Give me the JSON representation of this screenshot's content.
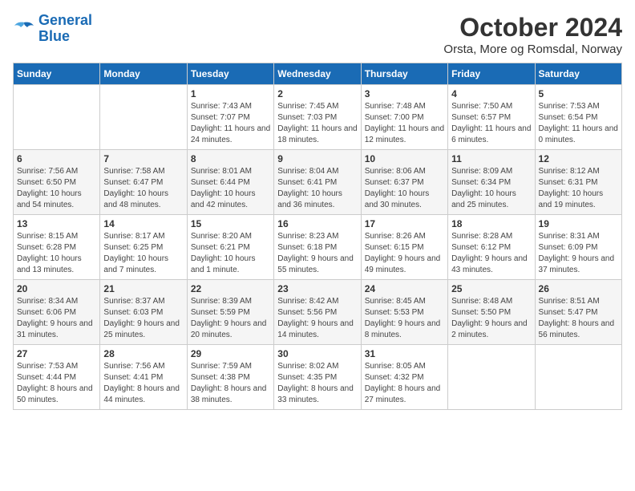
{
  "header": {
    "logo_line1": "General",
    "logo_line2": "Blue",
    "title": "October 2024",
    "subtitle": "Orsta, More og Romsdal, Norway"
  },
  "calendar": {
    "days_of_week": [
      "Sunday",
      "Monday",
      "Tuesday",
      "Wednesday",
      "Thursday",
      "Friday",
      "Saturday"
    ],
    "weeks": [
      [
        {
          "day": "",
          "empty": true
        },
        {
          "day": "",
          "empty": true
        },
        {
          "day": "1",
          "sunrise": "Sunrise: 7:43 AM",
          "sunset": "Sunset: 7:07 PM",
          "daylight": "Daylight: 11 hours and 24 minutes."
        },
        {
          "day": "2",
          "sunrise": "Sunrise: 7:45 AM",
          "sunset": "Sunset: 7:03 PM",
          "daylight": "Daylight: 11 hours and 18 minutes."
        },
        {
          "day": "3",
          "sunrise": "Sunrise: 7:48 AM",
          "sunset": "Sunset: 7:00 PM",
          "daylight": "Daylight: 11 hours and 12 minutes."
        },
        {
          "day": "4",
          "sunrise": "Sunrise: 7:50 AM",
          "sunset": "Sunset: 6:57 PM",
          "daylight": "Daylight: 11 hours and 6 minutes."
        },
        {
          "day": "5",
          "sunrise": "Sunrise: 7:53 AM",
          "sunset": "Sunset: 6:54 PM",
          "daylight": "Daylight: 11 hours and 0 minutes."
        }
      ],
      [
        {
          "day": "6",
          "sunrise": "Sunrise: 7:56 AM",
          "sunset": "Sunset: 6:50 PM",
          "daylight": "Daylight: 10 hours and 54 minutes."
        },
        {
          "day": "7",
          "sunrise": "Sunrise: 7:58 AM",
          "sunset": "Sunset: 6:47 PM",
          "daylight": "Daylight: 10 hours and 48 minutes."
        },
        {
          "day": "8",
          "sunrise": "Sunrise: 8:01 AM",
          "sunset": "Sunset: 6:44 PM",
          "daylight": "Daylight: 10 hours and 42 minutes."
        },
        {
          "day": "9",
          "sunrise": "Sunrise: 8:04 AM",
          "sunset": "Sunset: 6:41 PM",
          "daylight": "Daylight: 10 hours and 36 minutes."
        },
        {
          "day": "10",
          "sunrise": "Sunrise: 8:06 AM",
          "sunset": "Sunset: 6:37 PM",
          "daylight": "Daylight: 10 hours and 30 minutes."
        },
        {
          "day": "11",
          "sunrise": "Sunrise: 8:09 AM",
          "sunset": "Sunset: 6:34 PM",
          "daylight": "Daylight: 10 hours and 25 minutes."
        },
        {
          "day": "12",
          "sunrise": "Sunrise: 8:12 AM",
          "sunset": "Sunset: 6:31 PM",
          "daylight": "Daylight: 10 hours and 19 minutes."
        }
      ],
      [
        {
          "day": "13",
          "sunrise": "Sunrise: 8:15 AM",
          "sunset": "Sunset: 6:28 PM",
          "daylight": "Daylight: 10 hours and 13 minutes."
        },
        {
          "day": "14",
          "sunrise": "Sunrise: 8:17 AM",
          "sunset": "Sunset: 6:25 PM",
          "daylight": "Daylight: 10 hours and 7 minutes."
        },
        {
          "day": "15",
          "sunrise": "Sunrise: 8:20 AM",
          "sunset": "Sunset: 6:21 PM",
          "daylight": "Daylight: 10 hours and 1 minute."
        },
        {
          "day": "16",
          "sunrise": "Sunrise: 8:23 AM",
          "sunset": "Sunset: 6:18 PM",
          "daylight": "Daylight: 9 hours and 55 minutes."
        },
        {
          "day": "17",
          "sunrise": "Sunrise: 8:26 AM",
          "sunset": "Sunset: 6:15 PM",
          "daylight": "Daylight: 9 hours and 49 minutes."
        },
        {
          "day": "18",
          "sunrise": "Sunrise: 8:28 AM",
          "sunset": "Sunset: 6:12 PM",
          "daylight": "Daylight: 9 hours and 43 minutes."
        },
        {
          "day": "19",
          "sunrise": "Sunrise: 8:31 AM",
          "sunset": "Sunset: 6:09 PM",
          "daylight": "Daylight: 9 hours and 37 minutes."
        }
      ],
      [
        {
          "day": "20",
          "sunrise": "Sunrise: 8:34 AM",
          "sunset": "Sunset: 6:06 PM",
          "daylight": "Daylight: 9 hours and 31 minutes."
        },
        {
          "day": "21",
          "sunrise": "Sunrise: 8:37 AM",
          "sunset": "Sunset: 6:03 PM",
          "daylight": "Daylight: 9 hours and 25 minutes."
        },
        {
          "day": "22",
          "sunrise": "Sunrise: 8:39 AM",
          "sunset": "Sunset: 5:59 PM",
          "daylight": "Daylight: 9 hours and 20 minutes."
        },
        {
          "day": "23",
          "sunrise": "Sunrise: 8:42 AM",
          "sunset": "Sunset: 5:56 PM",
          "daylight": "Daylight: 9 hours and 14 minutes."
        },
        {
          "day": "24",
          "sunrise": "Sunrise: 8:45 AM",
          "sunset": "Sunset: 5:53 PM",
          "daylight": "Daylight: 9 hours and 8 minutes."
        },
        {
          "day": "25",
          "sunrise": "Sunrise: 8:48 AM",
          "sunset": "Sunset: 5:50 PM",
          "daylight": "Daylight: 9 hours and 2 minutes."
        },
        {
          "day": "26",
          "sunrise": "Sunrise: 8:51 AM",
          "sunset": "Sunset: 5:47 PM",
          "daylight": "Daylight: 8 hours and 56 minutes."
        }
      ],
      [
        {
          "day": "27",
          "sunrise": "Sunrise: 7:53 AM",
          "sunset": "Sunset: 4:44 PM",
          "daylight": "Daylight: 8 hours and 50 minutes."
        },
        {
          "day": "28",
          "sunrise": "Sunrise: 7:56 AM",
          "sunset": "Sunset: 4:41 PM",
          "daylight": "Daylight: 8 hours and 44 minutes."
        },
        {
          "day": "29",
          "sunrise": "Sunrise: 7:59 AM",
          "sunset": "Sunset: 4:38 PM",
          "daylight": "Daylight: 8 hours and 38 minutes."
        },
        {
          "day": "30",
          "sunrise": "Sunrise: 8:02 AM",
          "sunset": "Sunset: 4:35 PM",
          "daylight": "Daylight: 8 hours and 33 minutes."
        },
        {
          "day": "31",
          "sunrise": "Sunrise: 8:05 AM",
          "sunset": "Sunset: 4:32 PM",
          "daylight": "Daylight: 8 hours and 27 minutes."
        },
        {
          "day": "",
          "empty": true
        },
        {
          "day": "",
          "empty": true
        }
      ]
    ]
  }
}
